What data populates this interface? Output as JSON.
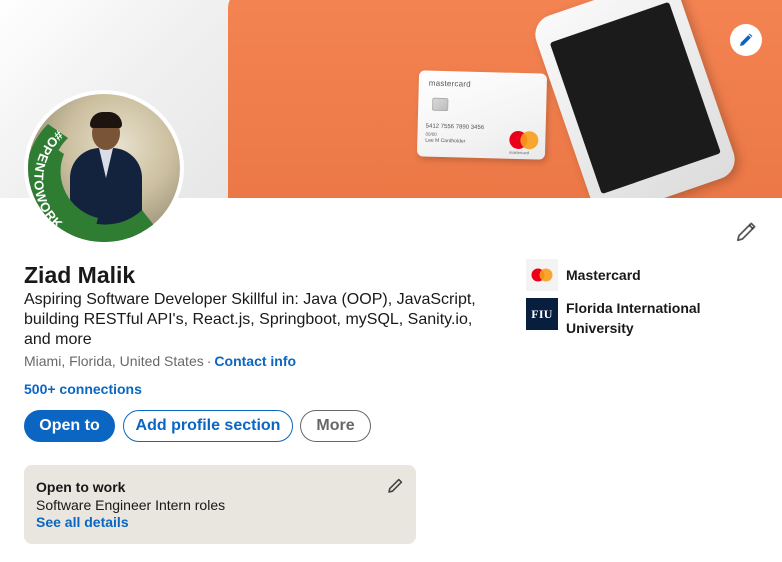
{
  "profile": {
    "name": "Ziad Malik",
    "headline": "Aspiring Software Developer Skillful in: Java (OOP), JavaScript, building RESTful API's, React.js, Springboot, mySQL, Sanity.io, and more",
    "location": "Miami, Florida, United States",
    "separator": "·",
    "contact_info": "Contact info",
    "connections": "500+ connections",
    "avatar_badge": "#OPENTOWORK"
  },
  "banner": {
    "card_brand_text": "mastercard",
    "card_number": "5412 7556 7890 3456",
    "card_expiry": "00/00",
    "card_holder": "Lee M Cardholder",
    "card_logo_text": "mastercard"
  },
  "actions": {
    "open_to": "Open to",
    "add_section": "Add profile section",
    "more": "More"
  },
  "open_to_work": {
    "title": "Open to work",
    "roles": "Software Engineer Intern roles",
    "details_link": "See all details"
  },
  "organizations": [
    {
      "name": "Mastercard",
      "logo": "mastercard-logo"
    },
    {
      "name": "Florida International University",
      "logo_text": "FIU"
    }
  ],
  "colors": {
    "primary": "#0a66c2",
    "banner_orange": "#f47c48",
    "open_to_work_green": "#2e7d32",
    "otw_box": "#e9e5df"
  }
}
